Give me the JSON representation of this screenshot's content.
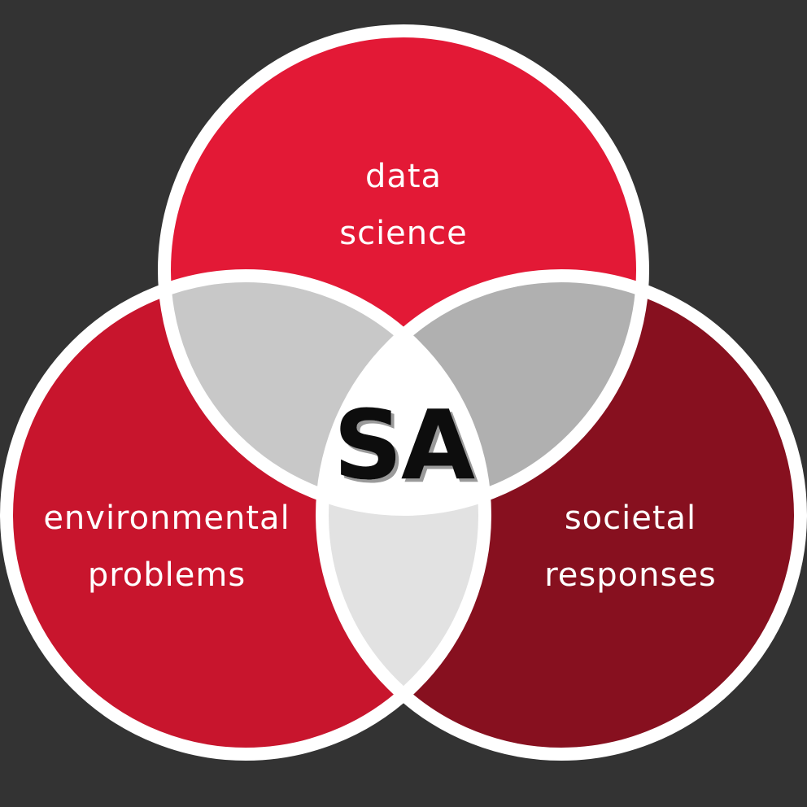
{
  "circles": {
    "top": {
      "line1": "data",
      "line2": "science",
      "color": "#E31936"
    },
    "left": {
      "line1": "environmental",
      "line2": "problems",
      "color": "#C8152D"
    },
    "right": {
      "line1": "societal",
      "line2": "responses",
      "color": "#87101F"
    }
  },
  "overlaps": {
    "top_left": {
      "color": "#C8C8C8"
    },
    "top_right": {
      "color": "#B0B0B0"
    },
    "left_right": {
      "color": "#E2E2E2"
    }
  },
  "center": {
    "label": "SA",
    "color": "#FFFFFF",
    "text_color": "#111111"
  },
  "colors": {
    "background": "#333333",
    "outline": "#FFFFFF"
  }
}
